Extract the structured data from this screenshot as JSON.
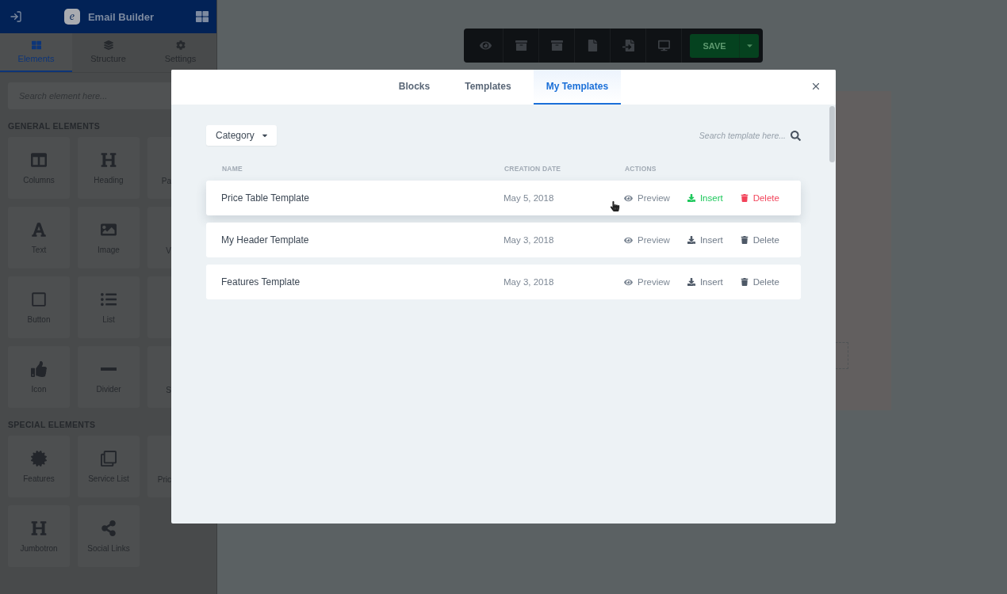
{
  "sidebar": {
    "logo": "e",
    "title": "Email Builder",
    "tabs": [
      {
        "label": "Elements",
        "selected": true
      },
      {
        "label": "Structure",
        "selected": false
      },
      {
        "label": "Settings",
        "selected": false
      }
    ],
    "search": {
      "placeholder": "Search element here..."
    },
    "sections": [
      {
        "title": "GENERAL ELEMENTS",
        "tiles": [
          {
            "label": "Columns"
          },
          {
            "label": "Heading"
          },
          {
            "label": "Pa"
          },
          {
            "label": "Text"
          },
          {
            "label": "Image"
          },
          {
            "label": "V"
          },
          {
            "label": "Button"
          },
          {
            "label": "List"
          },
          {
            "label": "Icon"
          },
          {
            "label": "Divider"
          },
          {
            "label": "S"
          }
        ]
      },
      {
        "title": "SPECIAL ELEMENTS",
        "tiles": [
          {
            "label": "Features"
          },
          {
            "label": "Service List"
          },
          {
            "label": "Pric"
          },
          {
            "label": "Jumbotron"
          },
          {
            "label": "Social Links"
          }
        ]
      }
    ]
  },
  "toolbar": {
    "save": "SAVE"
  },
  "modal": {
    "tabs": [
      {
        "label": "Blocks",
        "selected": false
      },
      {
        "label": "Templates",
        "selected": false
      },
      {
        "label": "My Templates",
        "selected": true
      }
    ],
    "category": "Category",
    "search": {
      "placeholder": "Search template here..."
    },
    "columns": [
      "NAME",
      "CREATION DATE",
      "ACTIONS"
    ],
    "rows": [
      {
        "name": "Price Table Template",
        "date": "May 5, 2018",
        "hovered": true,
        "actions": [
          "Preview",
          "Insert",
          "Delete"
        ]
      },
      {
        "name": "My Header Template",
        "date": "May 3, 2018",
        "hovered": false,
        "actions": [
          "Preview",
          "Insert",
          "Delete"
        ]
      },
      {
        "name": "Features Template",
        "date": "May 3, 2018",
        "hovered": false,
        "actions": [
          "Preview",
          "Insert",
          "Delete"
        ]
      }
    ]
  }
}
